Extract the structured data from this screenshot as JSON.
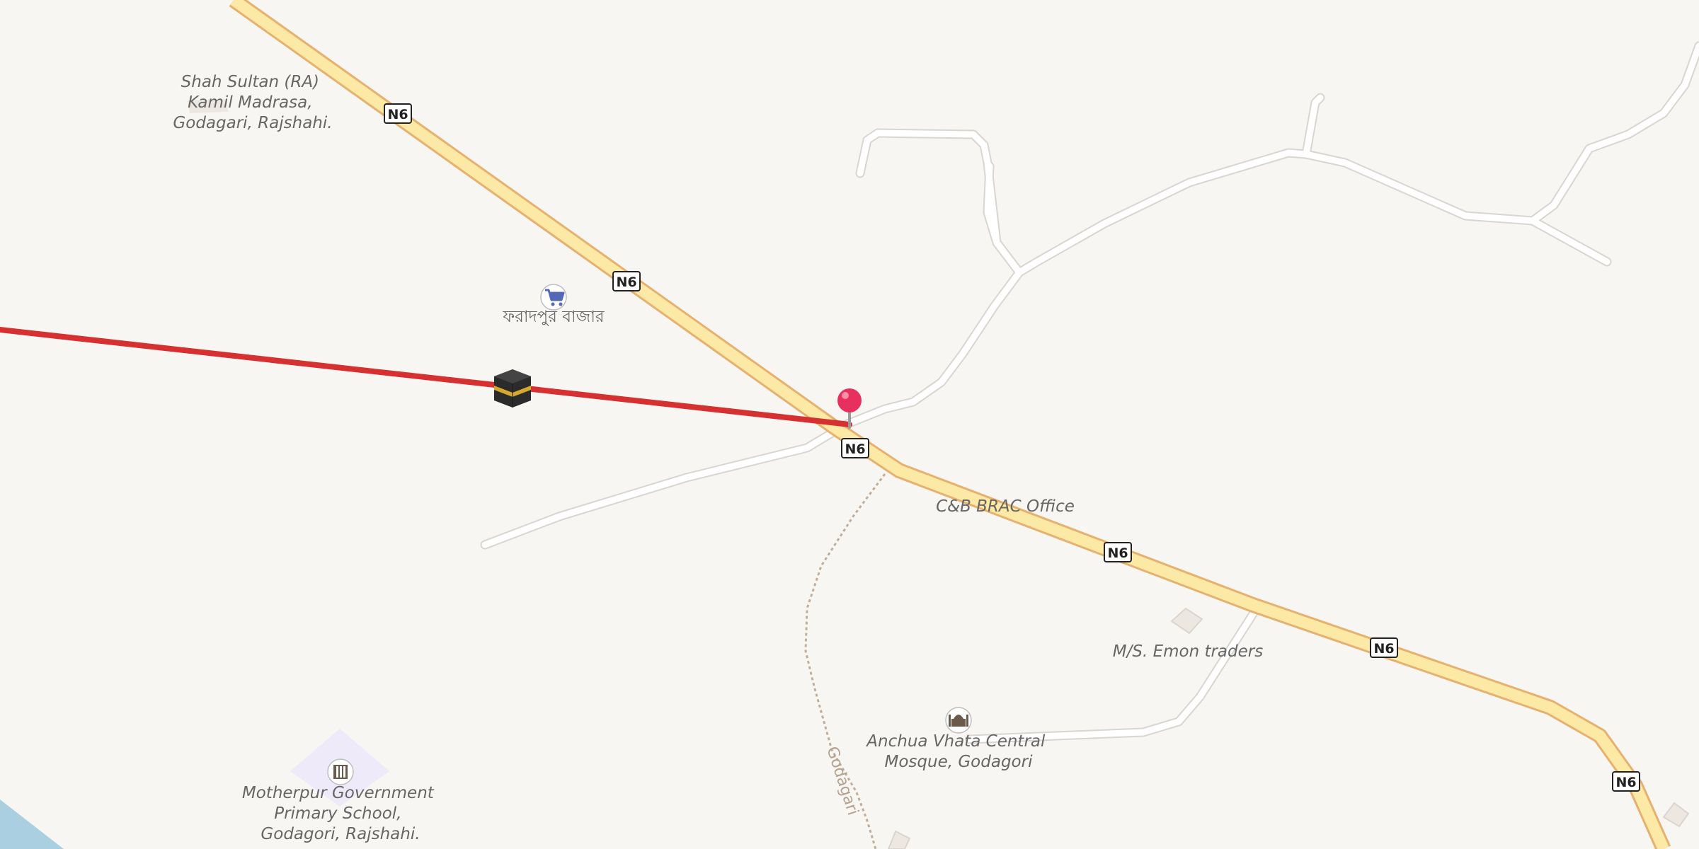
{
  "map": {
    "road_ref": "N6",
    "path_name": "Godagari",
    "colors": {
      "background": "#f8f6f2",
      "primary_road_fill": "#fde9a6",
      "primary_road_casing": "#e6b16f",
      "minor_road_fill": "#ffffff",
      "minor_road_casing": "#d9d5d0",
      "qibla_line": "#d63030",
      "pin": "#e8305e",
      "water": "#a9cfe0",
      "school_area": "#efeafa"
    },
    "icons": {
      "kaaba": "kaaba-icon",
      "pin": "location-pin-icon",
      "shop": "shopping-cart-icon",
      "mosque": "mosque-icon",
      "school": "school-icon"
    }
  },
  "labels": {
    "madrasa": [
      "Shah Sultan (RA)",
      "Kamil Madrasa,",
      "Godagari, Rajshahi."
    ],
    "bazar": "ফরাদপুর বাজার",
    "brac_office": "C&B BRAC Office",
    "emon_traders": "M/S. Emon traders",
    "mosque": [
      "Anchua Vhata Central",
      "Mosque, Godagori"
    ],
    "school": [
      "Motherpur Government",
      "Primary School,",
      "Godagori, Rajshahi."
    ]
  }
}
